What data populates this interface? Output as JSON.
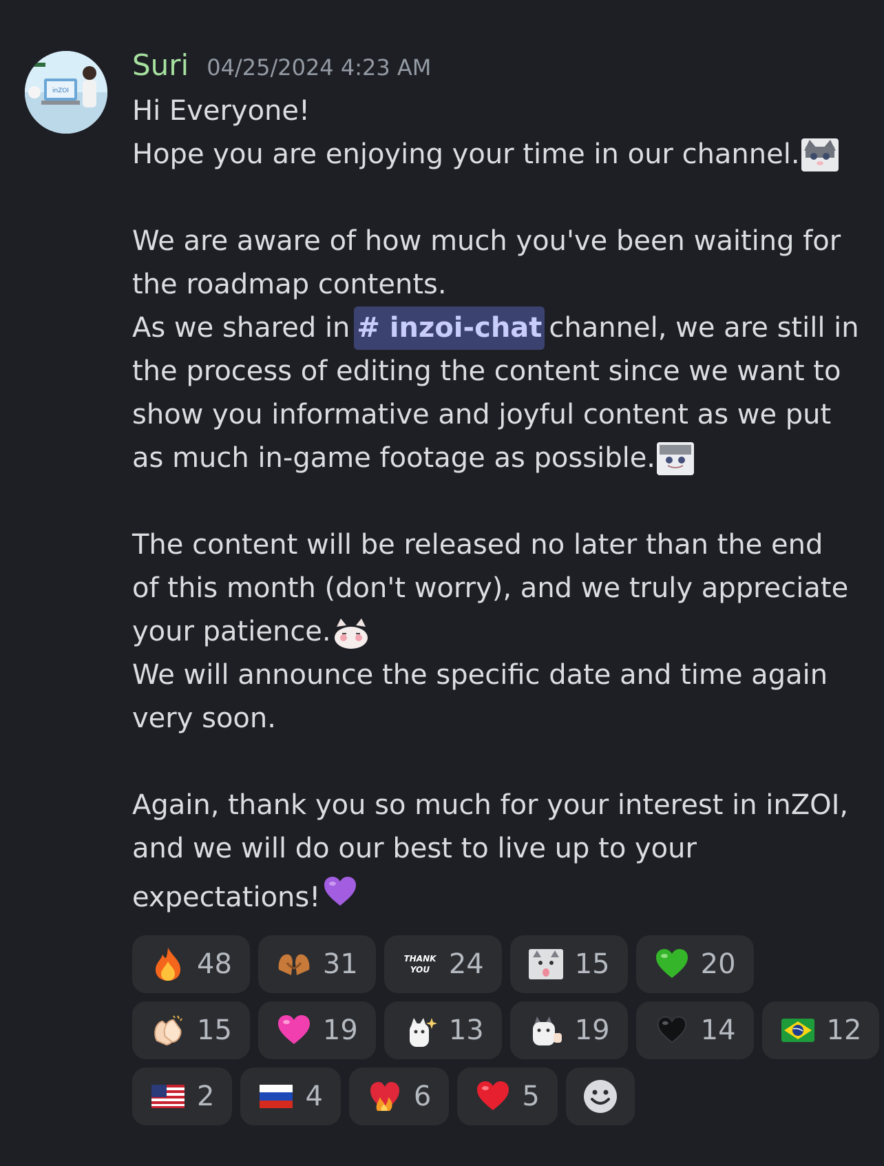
{
  "message": {
    "username": "Suri",
    "timestamp": "04/25/2024 4:23 AM",
    "avatar_icon": "inzoi-avatar",
    "mention": "# inzoi-chat",
    "lines": {
      "l1": "Hi Everyone!",
      "l2": "Hope you are enjoying your time in our channel.",
      "l3": "We are aware of how much you've been waiting for",
      "l4": "the roadmap contents.",
      "l5a": "As we shared in",
      "l5b": "channel, we are still in",
      "l6": "the process of editing the content since we want to",
      "l7": "show you informative and joyful content as we put",
      "l8": "as much in-game footage as possible.",
      "l9": "The content will be released no later than the end",
      "l10": "of this month (don't worry), and we truly appreciate",
      "l11": "your patience.",
      "l12": "We will announce the specific date and time again",
      "l13": "very soon.",
      "l14": "Again, thank you so much for your interest in inZOI,",
      "l15": "and we will do our best to live up to your",
      "l16": "expectations!"
    }
  },
  "reactions": [
    {
      "icon": "fire-icon",
      "glyph": "🔥",
      "count": "48"
    },
    {
      "icon": "heart-hands-icon",
      "glyph": "🫶",
      "count": "31"
    },
    {
      "icon": "thank-you-sticker-icon",
      "glyph": "THANK YOU",
      "count": "24"
    },
    {
      "icon": "cat-tongue-icon",
      "glyph": "",
      "count": "15"
    },
    {
      "icon": "green-heart-icon",
      "glyph": "💚",
      "count": "20"
    },
    {
      "icon": "clapping-hands-icon",
      "glyph": "👏",
      "count": "15"
    },
    {
      "icon": "pink-heart-icon",
      "glyph": "💗",
      "count": "19"
    },
    {
      "icon": "cat-sparkle-icon",
      "glyph": "",
      "count": "13"
    },
    {
      "icon": "cat-thumbs-icon",
      "glyph": "",
      "count": "19"
    },
    {
      "icon": "black-heart-icon",
      "glyph": "🖤",
      "count": "14"
    },
    {
      "icon": "brazil-flag-icon",
      "glyph": "🇧🇷",
      "count": "12"
    },
    {
      "icon": "us-flag-icon",
      "glyph": "🇺🇸",
      "count": "2"
    },
    {
      "icon": "russia-flag-icon",
      "glyph": "🇷🇺",
      "count": "4"
    },
    {
      "icon": "heart-on-fire-icon",
      "glyph": "❤️‍🔥",
      "count": "6"
    },
    {
      "icon": "red-heart-icon",
      "glyph": "❤️",
      "count": "5"
    }
  ],
  "add_reaction_icon": "add-reaction-smiley-icon",
  "colors": {
    "background": "#1e1f25",
    "username": "#a7e1a0",
    "mention_bg": "#3c4270",
    "reaction_bg": "#2b2d31"
  }
}
